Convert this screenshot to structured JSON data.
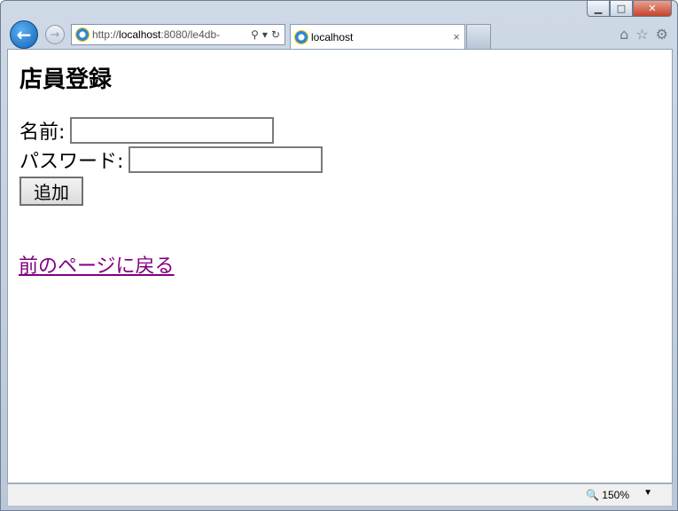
{
  "window": {
    "minimize_glyph": "▁",
    "maximize_glyph": "□",
    "close_glyph": "✕"
  },
  "toolbar": {
    "url_prefix": "http://",
    "url_host": "localhost",
    "url_rest": ":8080/le4db-",
    "tab_title": "localhost",
    "tab_close_glyph": "×"
  },
  "page": {
    "title": "店員登録",
    "name_label": "名前:",
    "password_label": "パスワード:",
    "add_button": "追加",
    "back_link": "前のページに戻る",
    "link_color": "#800080"
  },
  "statusbar": {
    "zoom": "150%"
  }
}
